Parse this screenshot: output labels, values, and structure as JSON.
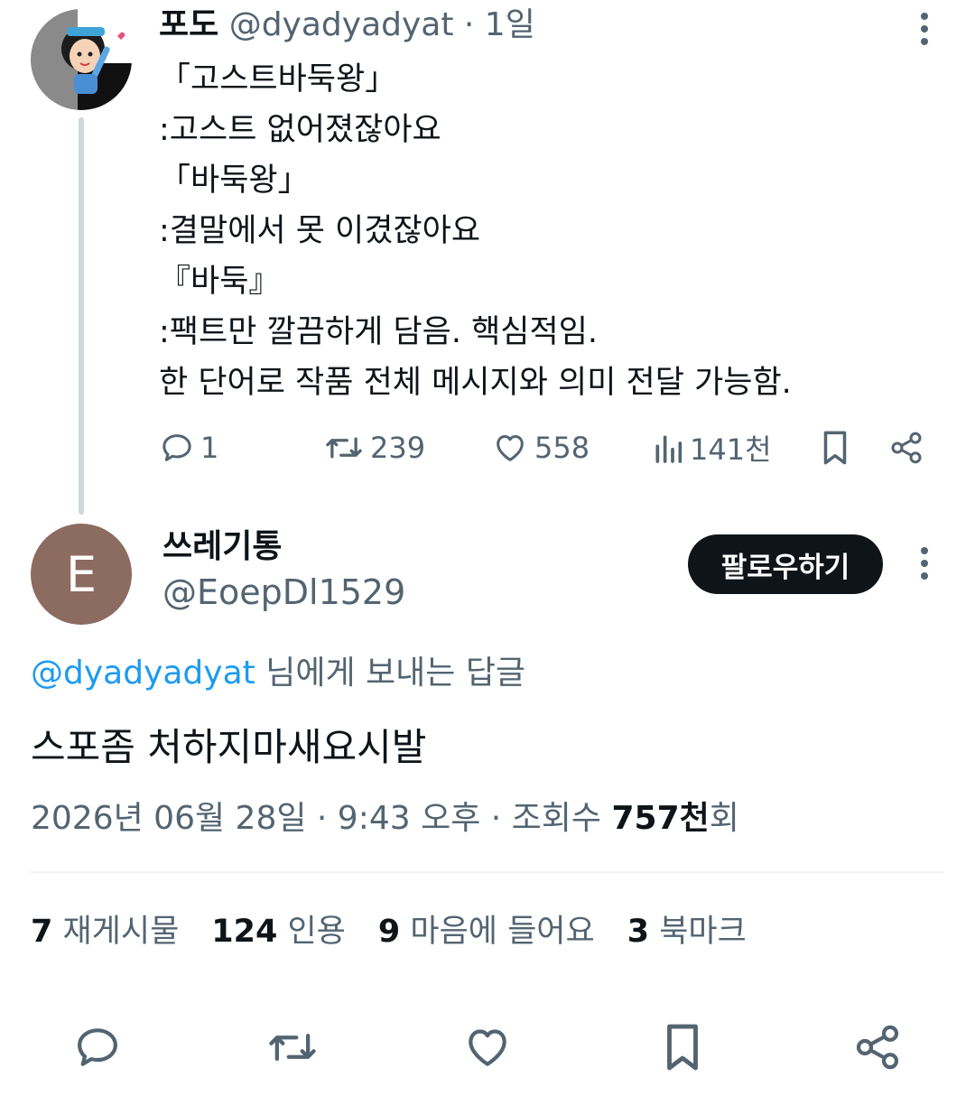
{
  "parent_tweet": {
    "display_name": "포도",
    "handle_meta": "@dyadyadyat · 1일",
    "lines": [
      "「고스트바둑왕」",
      ":고스트 없어졌잖아요",
      "「바둑왕」",
      ":결말에서 못 이겼잖아요",
      "『바둑』",
      ":팩트만 깔끔하게 담음. 핵심적임.",
      "한 단어로 작품 전체 메시지와 의미 전달 가능함."
    ],
    "actions": {
      "replies": "1",
      "retweets": "239",
      "likes": "558",
      "views": "141천"
    }
  },
  "reply_tweet": {
    "avatar_letter": "E",
    "display_name": "쓰레기통",
    "handle": "@EoepDl1529",
    "follow_label": "팔로우하기",
    "reply_to_mention": "@dyadyadyat",
    "reply_to_suffix": " 님에게 보내는 답글",
    "text": "스포좀 처하지마새요시발",
    "meta_prefix": "2026년 06월 28일 · 9:43 오후 · 조회수 ",
    "views_value": "757천",
    "views_suffix": "회",
    "stats": {
      "reposts_count": "7",
      "reposts_label": " 재게시물",
      "quotes_count": "124",
      "quotes_label": " 인용",
      "likes_count": "9",
      "likes_label": " 마음에 들어요",
      "bookmarks_count": "3",
      "bookmarks_label": " 북마크"
    }
  },
  "colors": {
    "text_primary": "#0f1419",
    "text_secondary": "#536471",
    "link": "#1d9bf0",
    "avatar_reply_bg": "#8c6b60"
  },
  "icons": [
    "reply-icon",
    "retweet-icon",
    "like-icon",
    "views-icon",
    "bookmark-icon",
    "share-icon",
    "more-icon"
  ]
}
